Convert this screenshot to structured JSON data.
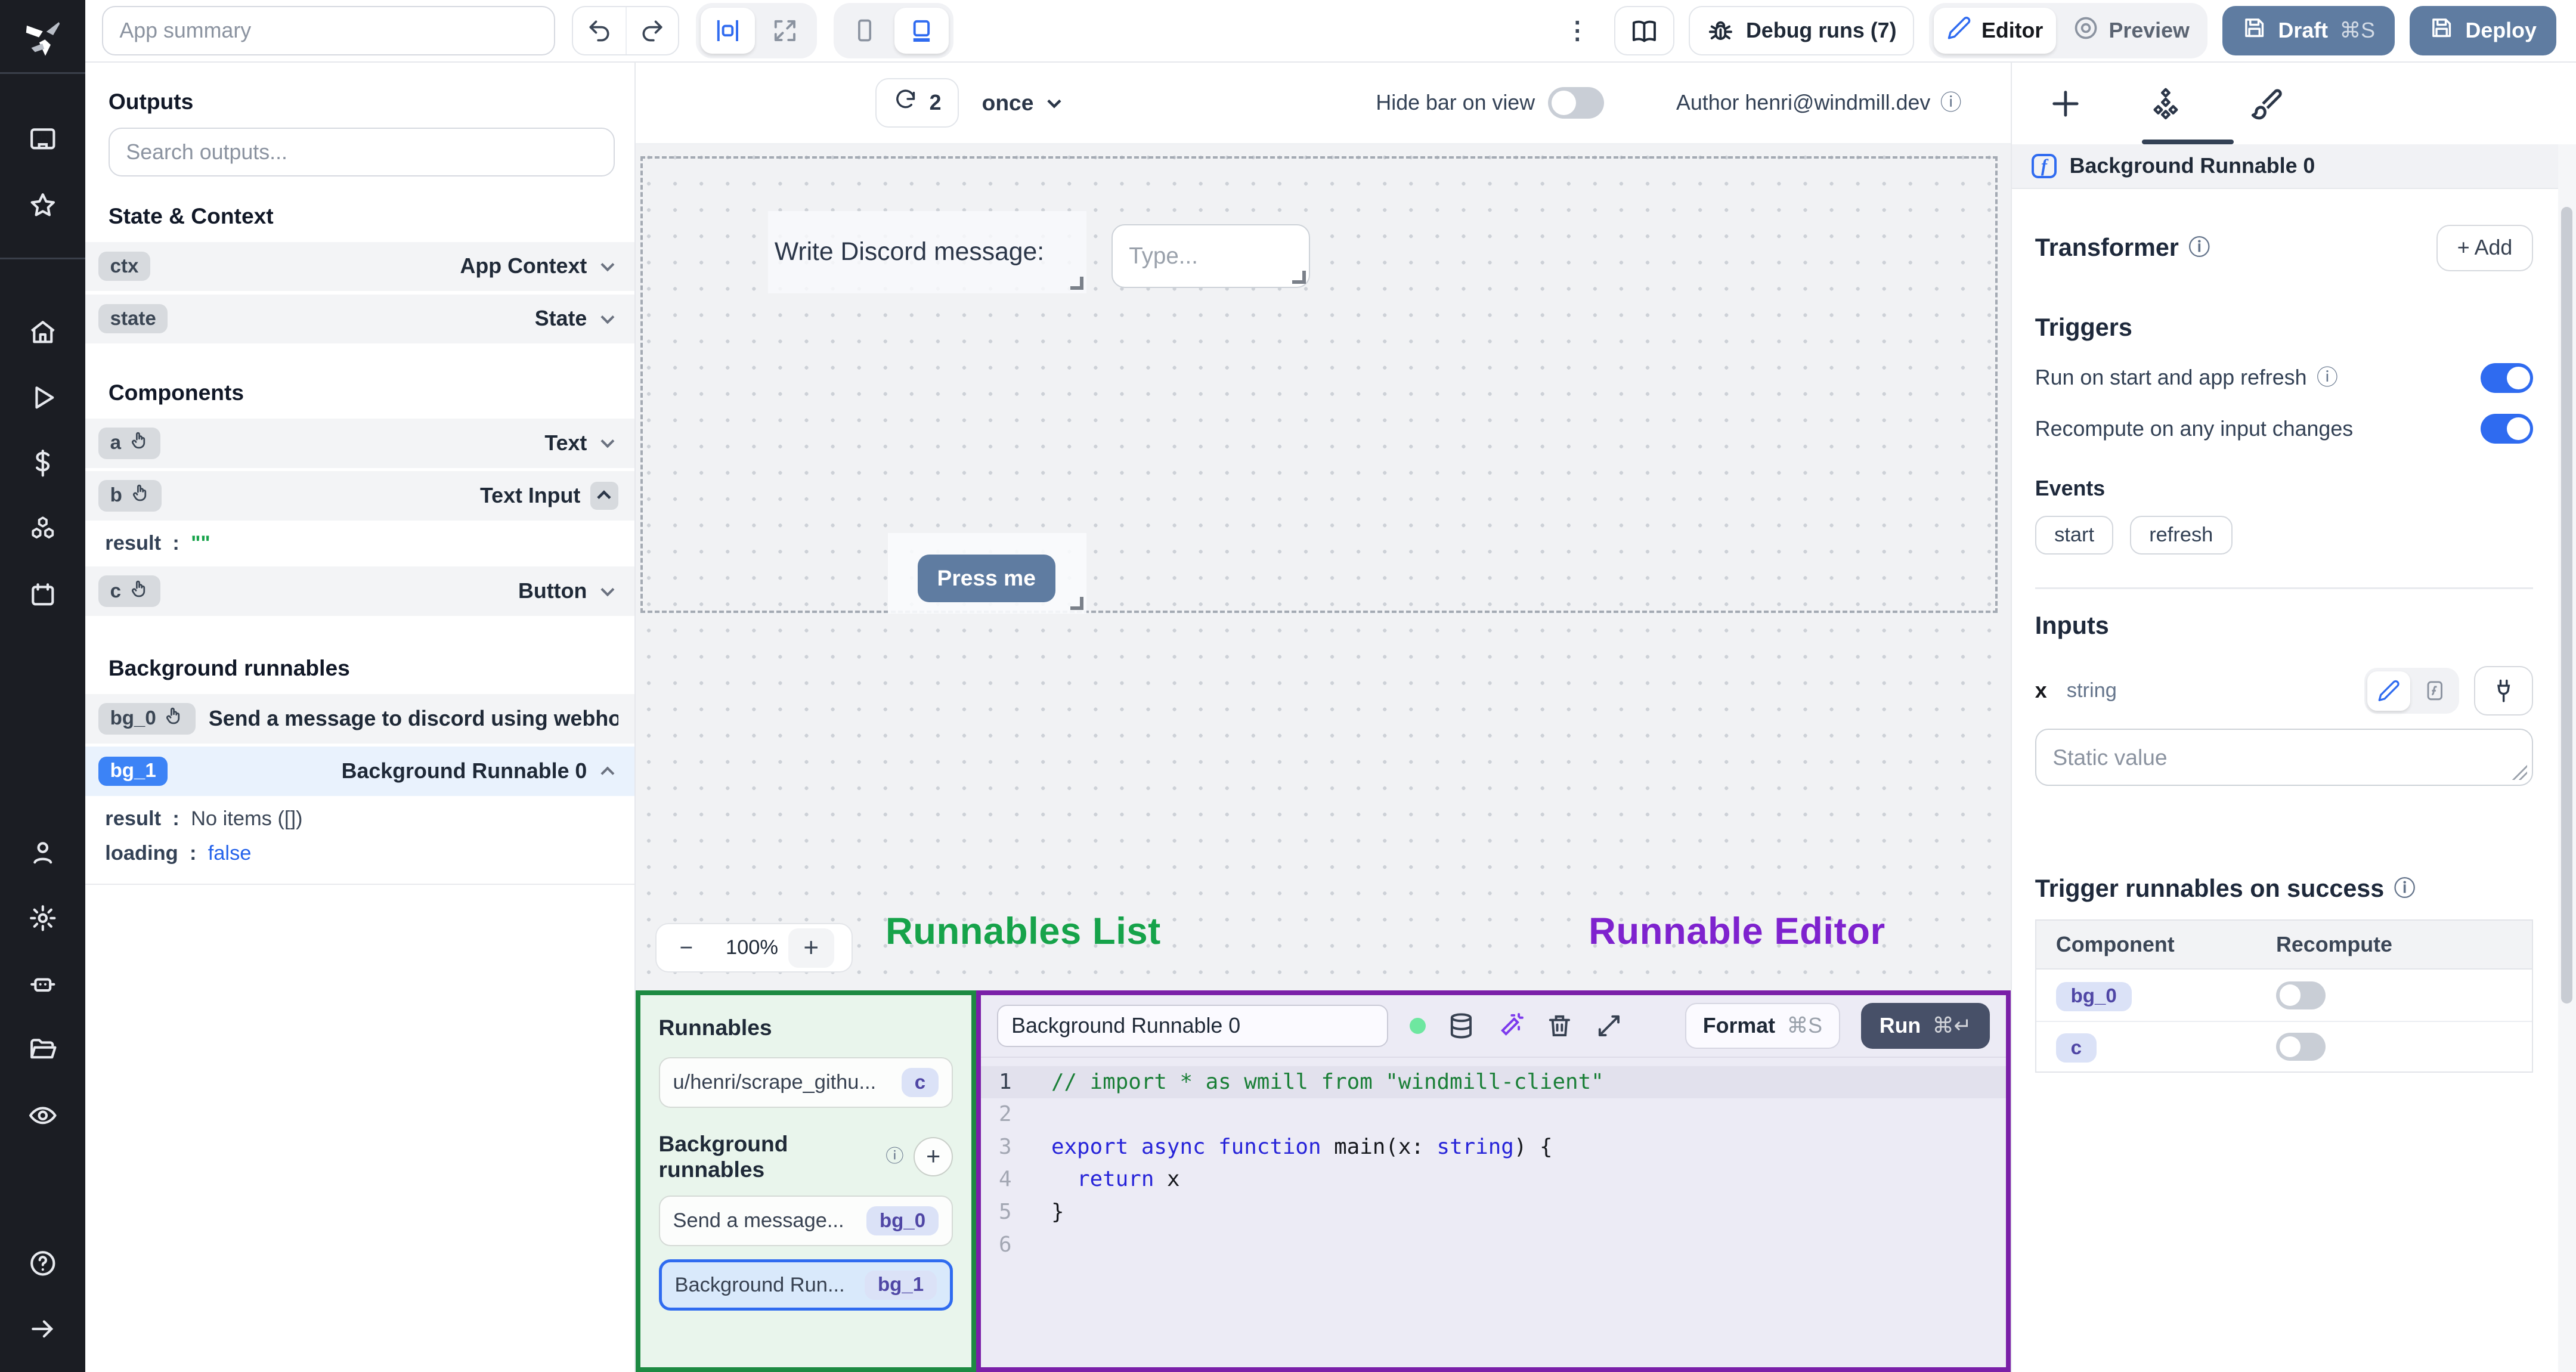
{
  "topbar": {
    "app_summary_placeholder": "App summary",
    "debug_runs_label": "Debug runs (7)",
    "editor_label": "Editor",
    "preview_label": "Preview",
    "draft_label": "Draft",
    "draft_kbd": "⌘S",
    "deploy_label": "Deploy"
  },
  "outputs": {
    "title": "Outputs",
    "search_placeholder": "Search outputs...",
    "state_context_title": "State & Context",
    "ctx": {
      "badge": "ctx",
      "type": "App Context"
    },
    "state": {
      "badge": "state",
      "type": "State"
    },
    "components_title": "Components",
    "a": {
      "badge": "a",
      "type": "Text"
    },
    "b": {
      "badge": "b",
      "type": "Text Input"
    },
    "b_result": {
      "key": "result",
      "colon": ":",
      "value": "\"\""
    },
    "c": {
      "badge": "c",
      "type": "Button"
    },
    "background_title": "Background runnables",
    "bg0": {
      "badge": "bg_0",
      "label": "Send a message to discord using webhoo"
    },
    "bg1": {
      "badge": "bg_1",
      "type": "Background Runnable 0"
    },
    "bg1_result": {
      "key": "result",
      "colon": ":",
      "value": "No items ([])"
    },
    "bg1_loading": {
      "key": "loading",
      "colon": ":",
      "value": "false"
    }
  },
  "canvas": {
    "refresh_count": "2",
    "interval": "once",
    "hide_bar_label": "Hide bar on view",
    "author": "Author henri@windmill.dev",
    "text_component": "Write Discord message:",
    "input_placeholder": "Type...",
    "button_label": "Press me",
    "zoom_minus": "−",
    "zoom_level": "100%",
    "zoom_plus": "+"
  },
  "annotations": {
    "runnables_list": "Runnables List",
    "runnable_editor": "Runnable Editor"
  },
  "runnables_panel": {
    "title": "Runnables",
    "item_script": {
      "name": "u/henri/scrape_githu...",
      "badge": "c"
    },
    "background_title": "Background runnables",
    "item_bg0": {
      "name": "Send a message...",
      "badge": "bg_0"
    },
    "item_bg1": {
      "name": "Background Run...",
      "badge": "bg_1"
    },
    "add_label": "+"
  },
  "editor": {
    "name": "Background Runnable 0",
    "format_label": "Format",
    "format_kbd": "⌘S",
    "run_label": "Run",
    "run_kbd": "⌘↵",
    "code_lines": [
      [
        [
          "// import * as wmill from \"windmill-client\"",
          "c-comment"
        ]
      ],
      [],
      [
        [
          "export async function ",
          "c-kw"
        ],
        [
          "main",
          "c-id"
        ],
        [
          "(x: ",
          "c-id"
        ],
        [
          "string",
          "c-kw"
        ],
        [
          ") {",
          "c-id"
        ]
      ],
      [
        [
          "  ",
          "c-id"
        ],
        [
          "return ",
          "c-kw"
        ],
        [
          "x",
          "c-id"
        ]
      ],
      [
        [
          "}",
          "c-id"
        ]
      ],
      []
    ]
  },
  "right": {
    "header": "Background Runnable 0",
    "f_glyph": "f",
    "transformer": {
      "title": "Transformer",
      "add_label": "+ Add",
      "info": "ⓘ"
    },
    "triggers": {
      "title": "Triggers",
      "row1": "Run on start and app refresh",
      "row2": "Recompute on any input changes",
      "events_title": "Events",
      "events": [
        "start",
        "refresh"
      ]
    },
    "inputs": {
      "title": "Inputs",
      "field": "x",
      "type": "string",
      "placeholder": "Static value"
    },
    "success": {
      "title": "Trigger runnables on success",
      "col1": "Component",
      "col2": "Recompute",
      "rows": [
        {
          "badge": "bg_0"
        },
        {
          "badge": "c"
        }
      ]
    },
    "info_glyph": "ⓘ"
  },
  "colors": {
    "accent_blue": "#2f6bf0",
    "slate_button": "#5f7ca1",
    "run_button": "#475068",
    "green_annotation": "#16a34a",
    "purple_annotation": "#7e22ce",
    "badge_blue": "#3c83f6"
  }
}
